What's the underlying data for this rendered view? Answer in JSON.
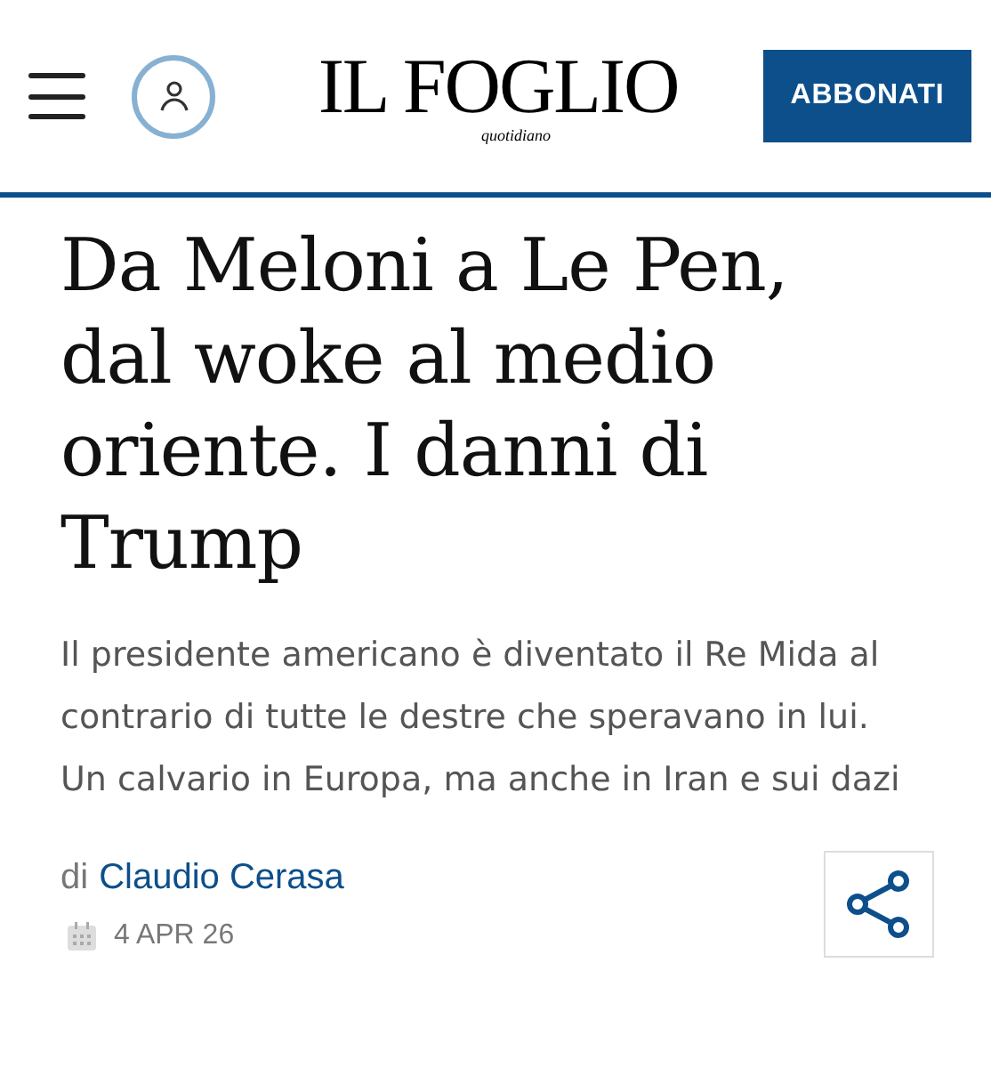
{
  "header": {
    "logo": "IL FOGLIO",
    "logo_subtitle": "quotidiano",
    "subscribe_button": "ABBONATI"
  },
  "article": {
    "headline": "Da Meloni a Le Pen, dal woke al medio oriente. I danni di Trump",
    "summary": "Il presidente americano è diventato il Re Mida al contrario di tutte le destre che speravano in lui. Un calvario in Europa, ma anche in Iran e sui dazi",
    "byline_prefix": "di",
    "author": "Claudio Cerasa",
    "date": "4 APR 26"
  }
}
